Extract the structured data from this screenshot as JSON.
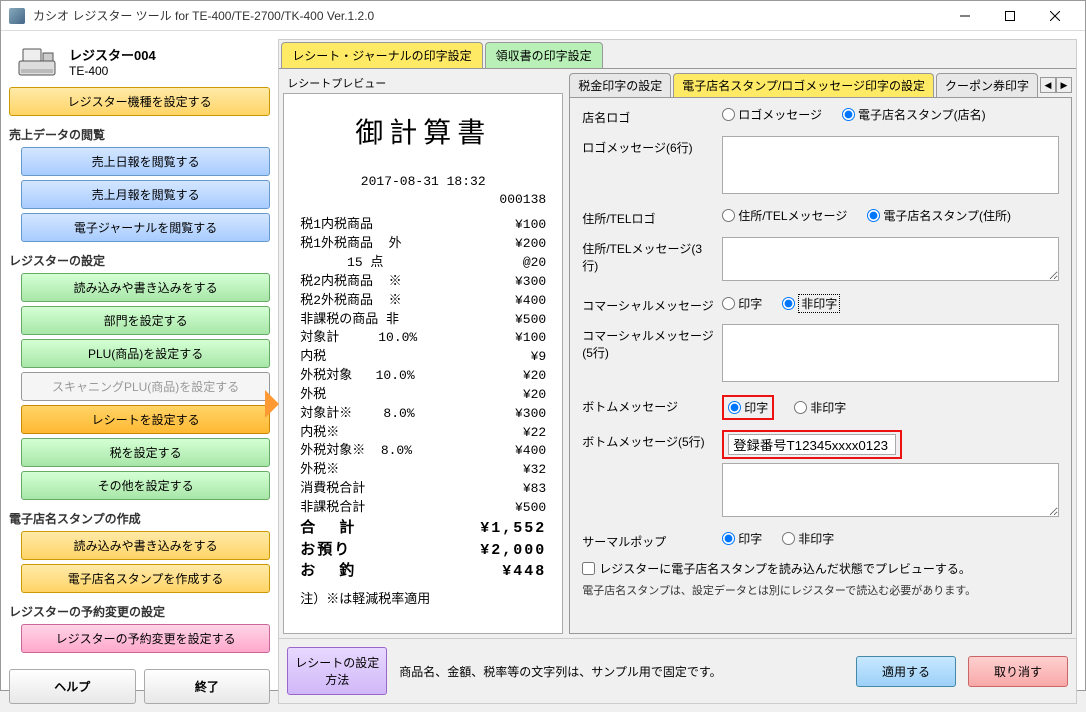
{
  "window": {
    "title": "カシオ レジスター ツール for TE-400/TE-2700/TK-400 Ver.1.2.0"
  },
  "register": {
    "name": "レジスター004",
    "model": "TE-400"
  },
  "sidebar": {
    "set_model": "レジスター機種を設定する",
    "sales_section": "売上データの閲覧",
    "sales_daily": "売上日報を閲覧する",
    "sales_monthly": "売上月報を閲覧する",
    "ejournal": "電子ジャーナルを閲覧する",
    "reg_section": "レジスターの設定",
    "reg_rw": "読み込みや書き込みをする",
    "reg_dept": "部門を設定する",
    "reg_plu": "PLU(商品)を設定する",
    "reg_scan": "スキャニングPLU(商品)を設定する",
    "reg_receipt": "レシートを設定する",
    "reg_tax": "税を設定する",
    "reg_other": "その他を設定する",
    "stamp_section": "電子店名スタンプの作成",
    "stamp_rw": "読み込みや書き込みをする",
    "stamp_create": "電子店名スタンプを作成する",
    "sched_section": "レジスターの予約変更の設定",
    "sched_set": "レジスターの予約変更を設定する",
    "help": "ヘルプ",
    "exit": "終了"
  },
  "main_tabs": {
    "receipt": "レシート・ジャーナルの印字設定",
    "ryoshu": "領収書の印字設定"
  },
  "preview": {
    "label": "レシートプレビュー",
    "title": "御計算書",
    "datetime": "2017-08-31 18:32",
    "seq": "000138",
    "lines": [
      {
        "l": "税1内税商品",
        "r": "¥100"
      },
      {
        "l": "税1外税商品  外",
        "r": "¥200"
      },
      {
        "l": "      15 点",
        "r": "@20"
      },
      {
        "l": "税2内税商品  ※",
        "r": "¥300"
      },
      {
        "l": "税2外税商品  ※",
        "r": "¥400"
      },
      {
        "l": "非課税の商品 非",
        "r": "¥500"
      },
      {
        "l": "対象計     10.0%",
        "r": "¥100"
      },
      {
        "l": "内税",
        "r": "¥9"
      },
      {
        "l": "外税対象   10.0%",
        "r": "¥20"
      },
      {
        "l": "外税",
        "r": "¥20"
      },
      {
        "l": "対象計※    8.0%",
        "r": "¥300"
      },
      {
        "l": "内税※",
        "r": "¥22"
      },
      {
        "l": "外税対象※  8.0%",
        "r": "¥400"
      },
      {
        "l": "外税※",
        "r": "¥32"
      },
      {
        "l": "消費税合計",
        "r": "¥83"
      },
      {
        "l": "非課税合計",
        "r": "¥500"
      }
    ],
    "totals": [
      {
        "l": "合  計",
        "r": "¥1,552"
      },
      {
        "l": "お預り",
        "r": "¥2,000"
      },
      {
        "l": "お  釣",
        "r": "¥448"
      }
    ],
    "note": "注）※は軽減税率適用"
  },
  "sub_tabs": {
    "tax": "税金印字の設定",
    "stamp": "電子店名スタンプ/ロゴメッセージ印字の設定",
    "coupon": "クーポン券印字"
  },
  "form": {
    "shop_logo": "店名ロゴ",
    "opt_logo_msg": "ロゴメッセージ",
    "opt_e_stamp_name": "電子店名スタンプ(店名)",
    "logo_msg": "ロゴメッセージ(6行)",
    "addr_logo": "住所/TELロゴ",
    "opt_addr_msg": "住所/TELメッセージ",
    "opt_e_stamp_addr": "電子店名スタンプ(住所)",
    "addr_msg": "住所/TELメッセージ(3行)",
    "commercial": "コマーシャルメッセージ",
    "opt_print": "印字",
    "opt_noprint": "非印字",
    "commercial_msg": "コマーシャルメッセージ(5行)",
    "bottom": "ボトムメッセージ",
    "bottom_msg": "ボトムメッセージ(5行)",
    "bottom_value": "登録番号T12345xxxx0123",
    "thermal": "サーマルポップ",
    "chk_preview": "レジスターに電子店名スタンプを読み込んだ状態でプレビューする。",
    "note2": "電子店名スタンプは、設定データとは別にレジスターで読込む必要があります。"
  },
  "footer": {
    "howto": "レシートの設定方法",
    "note": "商品名、金額、税率等の文字列は、サンプル用で固定です。",
    "apply": "適用する",
    "cancel": "取り消す"
  }
}
